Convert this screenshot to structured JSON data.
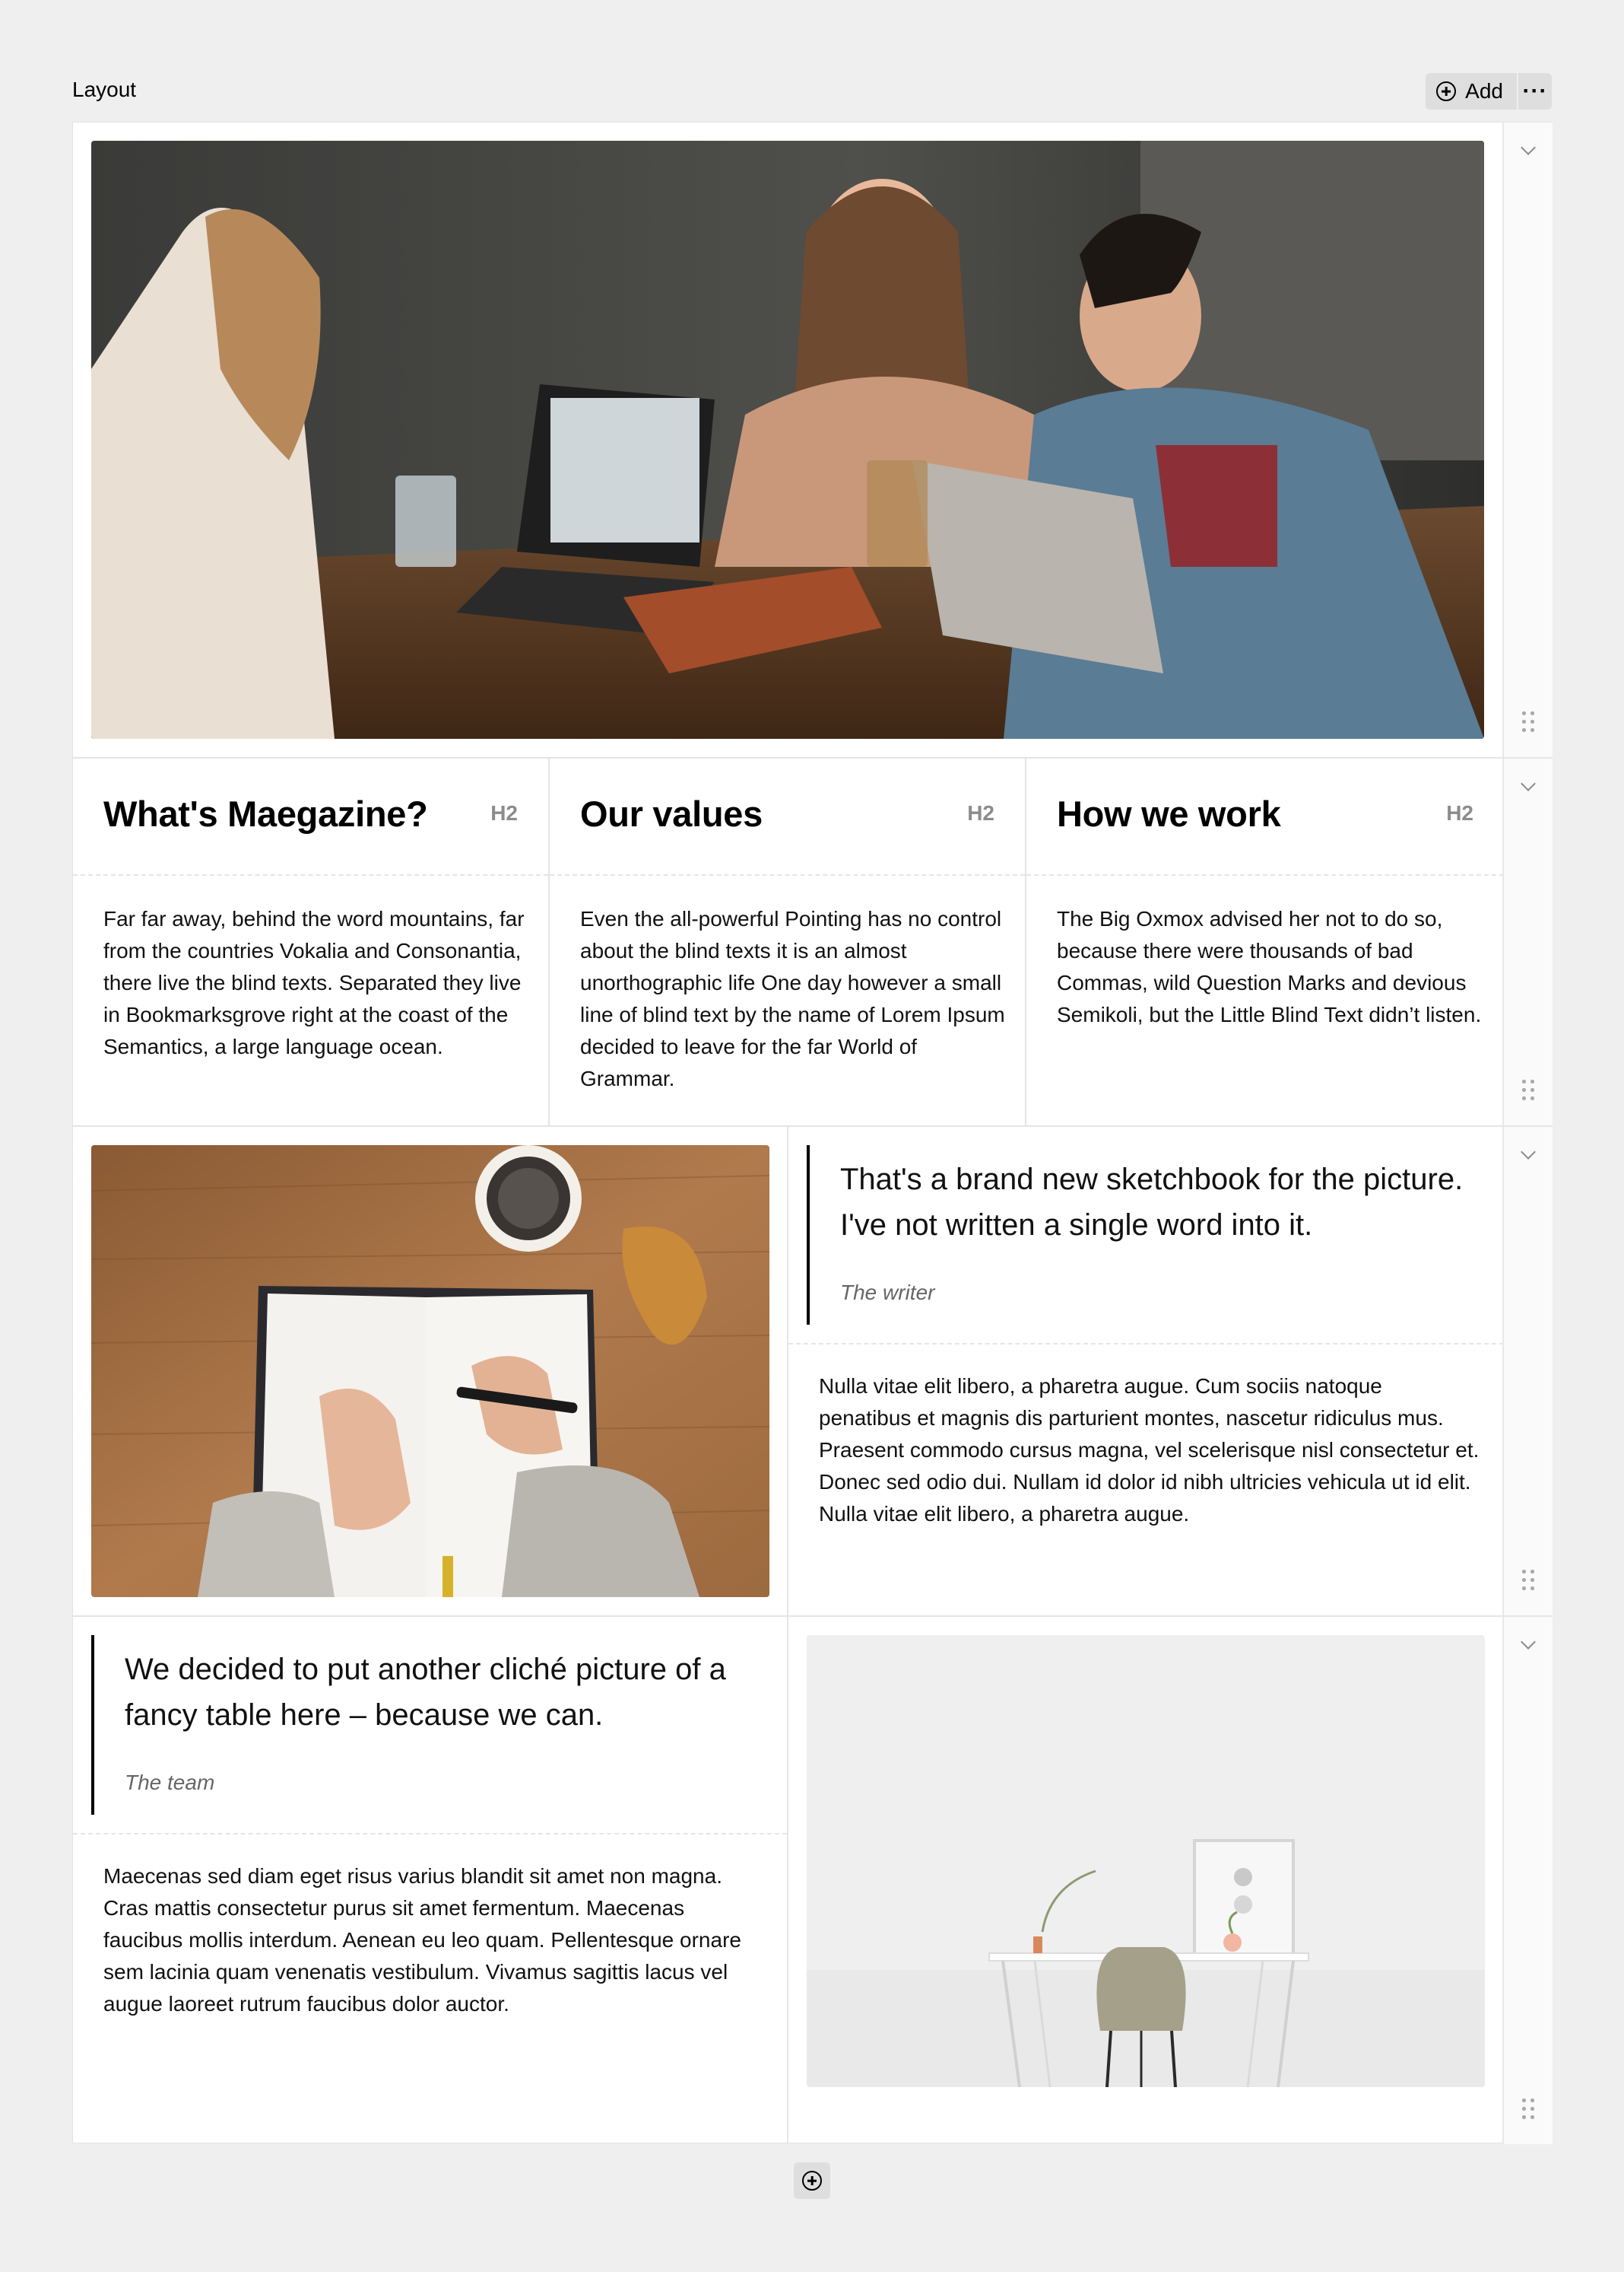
{
  "header": {
    "title": "Layout",
    "add_label": "Add",
    "more_label": "···",
    "icons": {
      "add": "plus-circle-icon",
      "more": "ellipsis-icon"
    }
  },
  "rows": [
    {
      "type": "image",
      "image": "photo of three people laughing around a wooden table with laptops and a leather notebook"
    },
    {
      "type": "columns",
      "columns": [
        {
          "heading": "What's Maegazine?",
          "heading_level": "H2",
          "text": "Far far away, behind the word mountains, far from the countries Vokalia and Consonantia, there live the blind texts. Separated they live in Bookmarksgrove right at the coast of the Semantics, a large language ocean."
        },
        {
          "heading": "Our values",
          "heading_level": "H2",
          "text": "Even the all-powerful Pointing has no control about the blind texts it is an almost unorthographic life One day however a small line of blind text by the name of Lorem Ipsum decided to leave for the far World of Grammar."
        },
        {
          "heading": "How we work",
          "heading_level": "H2",
          "text": "The Big Oxmox advised her not to do so, because there were thousands of bad Commas, wild Question Marks and devious Semikoli, but the Little Blind Text didn’t listen."
        }
      ]
    },
    {
      "type": "image-quote",
      "image": "person writing in a notebook on a wooden desk with coffee cup and croissant",
      "quote": "That's a brand new sketchbook for the picture. I've not written a single word into it.",
      "cite": "The writer",
      "text": "Nulla vitae elit libero, a pharetra augue. Cum sociis natoque penatibus et magnis dis parturient montes, nascetur ridiculus mus. Praesent commodo cursus magna, vel scelerisque nisl consectetur et. Donec sed odio dui. Nullam id dolor id nibh ultricies vehicula ut id elit. Nulla vitae elit libero, a pharetra augue."
    },
    {
      "type": "quote-image",
      "quote": "We decided to put another cliché picture of a fancy table here – because we can.",
      "cite": "The team",
      "text": "Maecenas sed diam eget risus varius blandit sit amet non magna. Cras mattis consectetur purus sit amet fermentum. Maecenas faucibus mollis interdum. Aenean eu leo quam. Pellentesque ornare sem lacinia quam venenatis vestibulum. Vivamus sagittis lacus vel augue laoreet rutrum faucibus dolor auctor.",
      "image": "minimal white desk with a grey chair, plants and framed picture against a white wall"
    }
  ],
  "row_controls": {
    "collapse_icon": "chevron-down-icon",
    "drag_icon": "drag-handle-icon"
  },
  "footer": {
    "add_icon": "plus-circle-icon"
  }
}
